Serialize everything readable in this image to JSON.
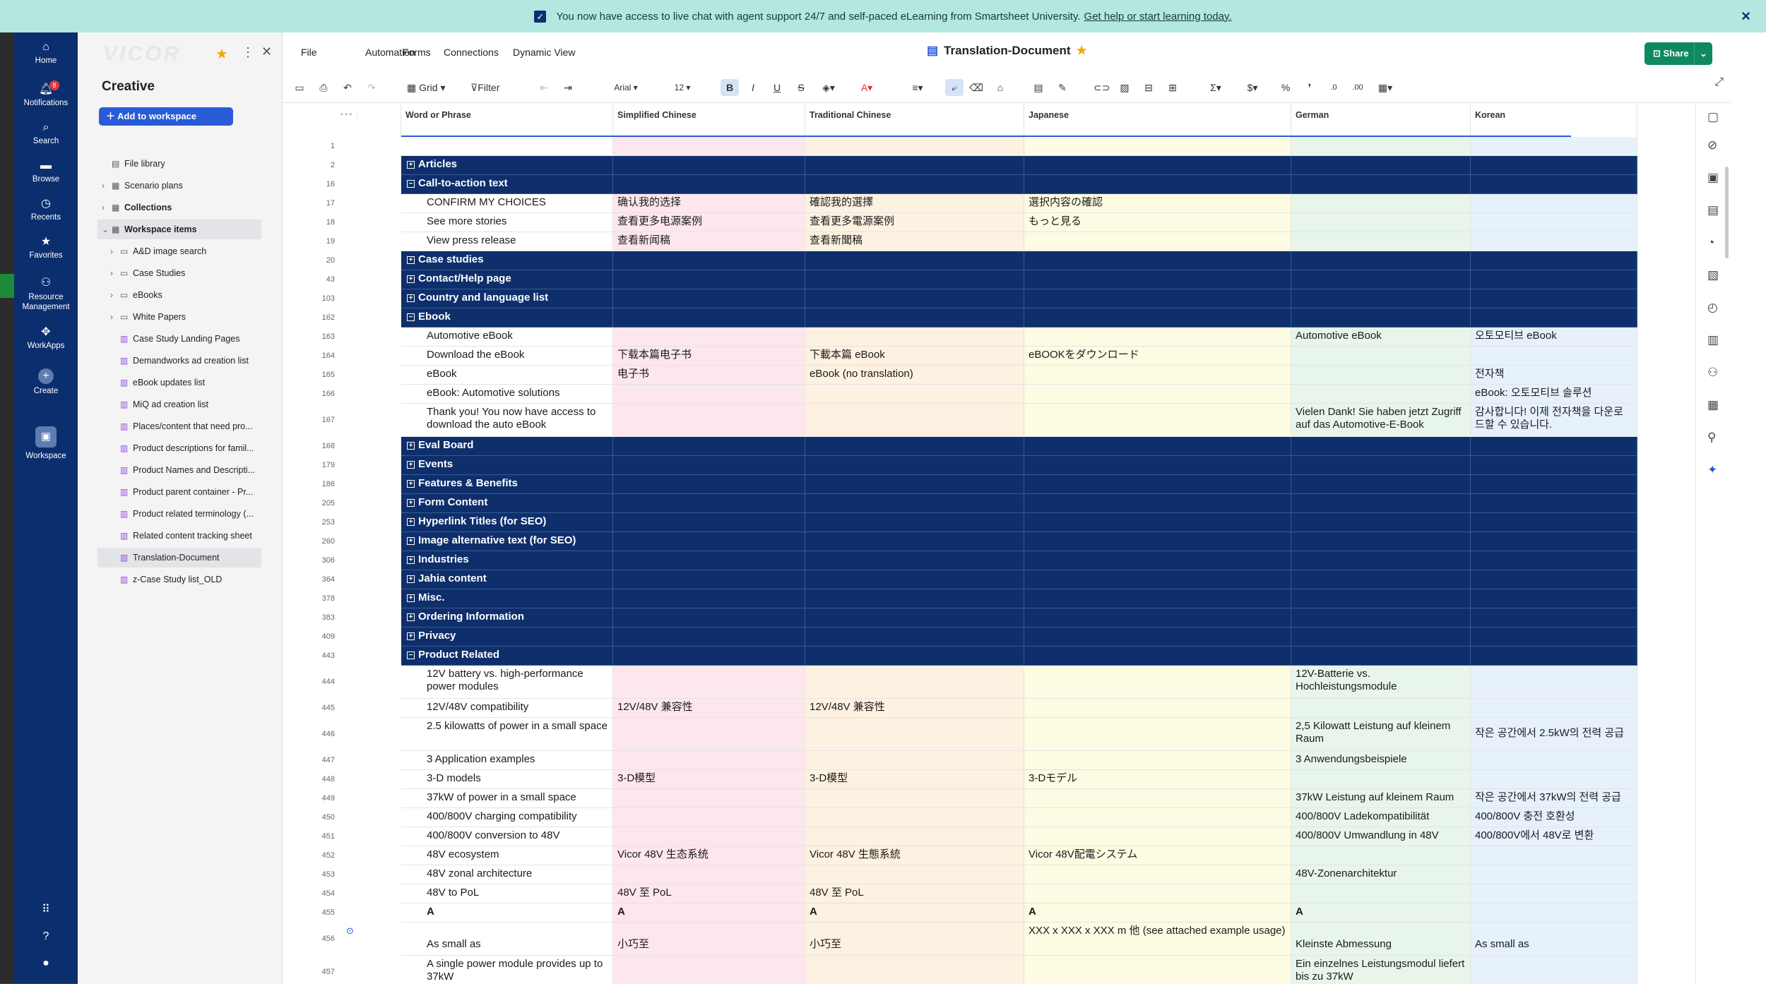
{
  "banner": {
    "text": "You now have access to live chat with agent support 24/7 and self-paced eLearning from Smartsheet University.",
    "link": "Get help or start learning today."
  },
  "nav": {
    "items": [
      {
        "label": "Home",
        "icon": "home-icon"
      },
      {
        "label": "Notifications",
        "icon": "bell-icon",
        "badge": "8"
      },
      {
        "label": "Search",
        "icon": "search-icon"
      },
      {
        "label": "Browse",
        "icon": "folder-icon"
      },
      {
        "label": "Recents",
        "icon": "clock-icon"
      },
      {
        "label": "Favorites",
        "icon": "star-icon"
      },
      {
        "label": "Resource Management",
        "icon": "people-icon"
      },
      {
        "label": "WorkApps",
        "icon": "workapps-icon"
      },
      {
        "label": "Create",
        "icon": "plus-icon"
      },
      {
        "label": "Workspace",
        "icon": "workspace-icon"
      }
    ]
  },
  "panel": {
    "logo": "VICOR",
    "workspace_name": "Creative",
    "add_button": "Add to workspace",
    "tree": [
      {
        "label": "File library",
        "icon": "file-icon",
        "level": 0,
        "arrow": false
      },
      {
        "label": "Scenario plans",
        "icon": "grid-icon",
        "level": 0,
        "arrow": true
      },
      {
        "label": "Collections",
        "icon": "grid-icon",
        "level": 0,
        "arrow": true,
        "bold": true
      },
      {
        "label": "Workspace items",
        "icon": "grid-icon",
        "level": 0,
        "arrow": true,
        "bold": true,
        "open": true,
        "selected": true
      },
      {
        "label": "A&D image search",
        "icon": "folder-icon",
        "level": 1,
        "arrow": true
      },
      {
        "label": "Case Studies",
        "icon": "folder-icon",
        "level": 1,
        "arrow": true
      },
      {
        "label": "eBooks",
        "icon": "folder-icon",
        "level": 1,
        "arrow": true
      },
      {
        "label": "White Papers",
        "icon": "folder-icon",
        "level": 1,
        "arrow": true
      },
      {
        "label": "Case Study Landing Pages",
        "icon": "sheet-icon",
        "level": 1,
        "arrow": false
      },
      {
        "label": "Demandworks ad creation list",
        "icon": "sheet-icon",
        "level": 1,
        "arrow": false
      },
      {
        "label": "eBook updates list",
        "icon": "sheet-icon",
        "level": 1,
        "arrow": false
      },
      {
        "label": "MiQ ad creation list",
        "icon": "sheet-icon",
        "level": 1,
        "arrow": false
      },
      {
        "label": "Places/content that need pro...",
        "icon": "sheet-icon",
        "level": 1,
        "arrow": false
      },
      {
        "label": "Product descriptions for famil...",
        "icon": "sheet-icon",
        "level": 1,
        "arrow": false
      },
      {
        "label": "Product Names and Descripti...",
        "icon": "sheet-icon",
        "level": 1,
        "arrow": false
      },
      {
        "label": "Product parent container - Pr...",
        "icon": "sheet-icon",
        "level": 1,
        "arrow": false
      },
      {
        "label": "Product related terminology (...",
        "icon": "sheet-icon",
        "level": 1,
        "arrow": false
      },
      {
        "label": "Related content tracking sheet",
        "icon": "sheet-icon",
        "level": 1,
        "arrow": false
      },
      {
        "label": "Translation-Document",
        "icon": "sheet-icon",
        "level": 1,
        "arrow": false,
        "selected": true
      },
      {
        "label": "z-Case Study list_OLD",
        "icon": "sheet-icon",
        "level": 1,
        "arrow": false
      }
    ]
  },
  "menu": {
    "items": [
      "File",
      "Automation",
      "Forms",
      "Connections",
      "Dynamic View"
    ],
    "title": "Translation-Document",
    "share": "Share"
  },
  "toolbar": {
    "view": "Grid",
    "filter": "Filter",
    "font": "Arial",
    "font_size": "12"
  },
  "columns": [
    "Word or Phrase",
    "Simplified Chinese",
    "Traditional Chinese",
    "Japanese",
    "German",
    "Korean"
  ],
  "rows": [
    {
      "n": "1",
      "h": 27,
      "type": "row",
      "cells": [
        "",
        "",
        "",
        "",
        "",
        ""
      ]
    },
    {
      "n": "2",
      "h": 27,
      "type": "group",
      "sign": "+",
      "cells": [
        "Articles",
        "",
        "",
        "",
        "",
        ""
      ]
    },
    {
      "n": "16",
      "h": 27,
      "type": "group",
      "sign": "−",
      "cells": [
        "Call-to-action text",
        "",
        "",
        "",
        "",
        ""
      ]
    },
    {
      "n": "17",
      "h": 27,
      "type": "child",
      "cells": [
        "CONFIRM MY CHOICES",
        "确认我的选择",
        "確認我的選擇",
        "選択内容の確認",
        "",
        ""
      ]
    },
    {
      "n": "18",
      "h": 27,
      "type": "child",
      "cells": [
        "See more stories",
        "查看更多电源案例",
        "查看更多電源案例",
        "もっと見る",
        "",
        ""
      ]
    },
    {
      "n": "19",
      "h": 27,
      "type": "child",
      "cells": [
        "View press release",
        "查看新闻稿",
        "查看新聞稿",
        "",
        "",
        ""
      ]
    },
    {
      "n": "20",
      "h": 27,
      "type": "group",
      "sign": "+",
      "cells": [
        "Case studies",
        "",
        "",
        "",
        "",
        ""
      ]
    },
    {
      "n": "43",
      "h": 27,
      "type": "group",
      "sign": "+",
      "cells": [
        "Contact/Help page",
        "",
        "",
        "",
        "",
        ""
      ]
    },
    {
      "n": "103",
      "h": 27,
      "type": "group",
      "sign": "+",
      "cells": [
        "Country and language list",
        "",
        "",
        "",
        "",
        ""
      ]
    },
    {
      "n": "162",
      "h": 27,
      "type": "group",
      "sign": "−",
      "cells": [
        "Ebook",
        "",
        "",
        "",
        "",
        ""
      ]
    },
    {
      "n": "163",
      "h": 27,
      "type": "child",
      "cells": [
        "Automotive eBook",
        "",
        "",
        "",
        "Automotive eBook",
        "오토모티브 eBook"
      ]
    },
    {
      "n": "164",
      "h": 27,
      "type": "child",
      "cells": [
        "Download the eBook",
        "下载本篇电子书",
        "下載本篇 eBook",
        "eBOOKをダウンロード",
        "",
        ""
      ]
    },
    {
      "n": "165",
      "h": 27,
      "type": "child",
      "cells": [
        "eBook",
        "电子书",
        "eBook (no translation)",
        "",
        "",
        "전자책"
      ]
    },
    {
      "n": "166",
      "h": 27,
      "type": "child",
      "cells": [
        "eBook: Automotive solutions",
        "",
        "",
        "",
        "",
        "eBook: 오토모티브 솔루션"
      ]
    },
    {
      "n": "167",
      "h": 47,
      "type": "child",
      "cells": [
        "Thank you! You now have access to download the auto eBook",
        "",
        "",
        "",
        "Vielen Dank! Sie haben jetzt Zugriff auf das Automotive-E-Book",
        "감사합니다! 이제 전자책을 다운로드할 수 있습니다."
      ]
    },
    {
      "n": "168",
      "h": 27,
      "type": "group",
      "sign": "+",
      "cells": [
        "Eval Board",
        "",
        "",
        "",
        "",
        ""
      ]
    },
    {
      "n": "179",
      "h": 27,
      "type": "group",
      "sign": "+",
      "cells": [
        "Events",
        "",
        "",
        "",
        "",
        ""
      ]
    },
    {
      "n": "186",
      "h": 27,
      "type": "group",
      "sign": "+",
      "cells": [
        "Features & Benefits",
        "",
        "",
        "",
        "",
        ""
      ]
    },
    {
      "n": "205",
      "h": 27,
      "type": "group",
      "sign": "+",
      "cells": [
        "Form Content",
        "",
        "",
        "",
        "",
        ""
      ]
    },
    {
      "n": "253",
      "h": 27,
      "type": "group",
      "sign": "+",
      "cells": [
        "Hyperlink Titles (for SEO)",
        "",
        "",
        "",
        "",
        ""
      ]
    },
    {
      "n": "260",
      "h": 27,
      "type": "group",
      "sign": "+",
      "cells": [
        "Image alternative text (for SEO)",
        "",
        "",
        "",
        "",
        ""
      ]
    },
    {
      "n": "306",
      "h": 27,
      "type": "group",
      "sign": "+",
      "cells": [
        "Industries",
        "",
        "",
        "",
        "",
        ""
      ]
    },
    {
      "n": "364",
      "h": 27,
      "type": "group",
      "sign": "+",
      "cells": [
        "Jahia content",
        "",
        "",
        "",
        "",
        ""
      ]
    },
    {
      "n": "378",
      "h": 27,
      "type": "group",
      "sign": "+",
      "cells": [
        "Misc.",
        "",
        "",
        "",
        "",
        ""
      ]
    },
    {
      "n": "383",
      "h": 27,
      "type": "group",
      "sign": "+",
      "cells": [
        "Ordering Information",
        "",
        "",
        "",
        "",
        ""
      ]
    },
    {
      "n": "409",
      "h": 27,
      "type": "group",
      "sign": "+",
      "cells": [
        "Privacy",
        "",
        "",
        "",
        "",
        ""
      ]
    },
    {
      "n": "443",
      "h": 27,
      "type": "group",
      "sign": "−",
      "cells": [
        "Product Related",
        "",
        "",
        "",
        "",
        ""
      ]
    },
    {
      "n": "444",
      "h": 47,
      "type": "child",
      "cells": [
        "12V battery vs. high-performance power modules",
        "",
        "",
        "",
        "12V-Batterie vs. Hochleistungsmodule",
        ""
      ]
    },
    {
      "n": "445",
      "h": 27,
      "type": "child",
      "cells": [
        "12V/48V compatibility",
        "12V/48V 兼容性",
        "12V/48V 兼容性",
        "",
        "",
        ""
      ]
    },
    {
      "n": "446",
      "h": 47,
      "type": "child",
      "cells": [
        "2.5 kilowatts of power in a small space",
        "",
        "",
        "",
        "2,5 Kilowatt Leistung auf kleinem Raum",
        "작은 공간에서 2.5kW의 전력 공급"
      ]
    },
    {
      "n": "447",
      "h": 27,
      "type": "child",
      "cells": [
        "3 Application examples",
        "",
        "",
        "",
        "3 Anwendungsbeispiele",
        ""
      ]
    },
    {
      "n": "448",
      "h": 27,
      "type": "child",
      "cells": [
        "3-D models",
        "3-D模型",
        "3-D模型",
        "3-Dモデル",
        "",
        ""
      ]
    },
    {
      "n": "449",
      "h": 27,
      "type": "child",
      "cells": [
        "37kW of power in a small space",
        "",
        "",
        "",
        "37kW Leistung auf kleinem Raum",
        "작은 공간에서 37kW의 전력 공급"
      ]
    },
    {
      "n": "450",
      "h": 27,
      "type": "child",
      "cells": [
        "400/800V charging compatibility",
        "",
        "",
        "",
        "400/800V Ladekompatibilität",
        "400/800V 충전 호환성"
      ]
    },
    {
      "n": "451",
      "h": 27,
      "type": "child",
      "cells": [
        "400/800V conversion to 48V",
        "",
        "",
        "",
        "400/800V Umwandlung in 48V",
        "400/800V에서 48V로 변환"
      ]
    },
    {
      "n": "452",
      "h": 27,
      "type": "child",
      "cells": [
        "48V ecosystem",
        "Vicor 48V 生态系统",
        "Vicor 48V 生態系統",
        "Vicor 48V配電システム",
        "",
        ""
      ]
    },
    {
      "n": "453",
      "h": 27,
      "type": "child",
      "cells": [
        "48V zonal architecture",
        "",
        "",
        "",
        "48V-Zonenarchitektur",
        ""
      ]
    },
    {
      "n": "454",
      "h": 27,
      "type": "child",
      "cells": [
        "48V to PoL",
        "48V 至 PoL",
        "48V 至 PoL",
        "",
        "",
        ""
      ]
    },
    {
      "n": "455",
      "h": 27,
      "type": "bold",
      "cells": [
        "A",
        "A",
        "A",
        "A",
        "A",
        ""
      ]
    },
    {
      "n": "456",
      "h": 47,
      "type": "child",
      "attach": true,
      "cells": [
        "As small as",
        "小巧至",
        "小巧至",
        "XXX x XXX x XXX m 他 (see attached example usage)",
        "Kleinste Abmessung",
        "As small as"
      ]
    },
    {
      "n": "457",
      "h": 47,
      "type": "child",
      "cells": [
        "A single power module provides up to 37kW",
        "",
        "",
        "",
        "Ein einzelnes Leistungsmodul liefert bis zu 37kW",
        ""
      ]
    }
  ]
}
